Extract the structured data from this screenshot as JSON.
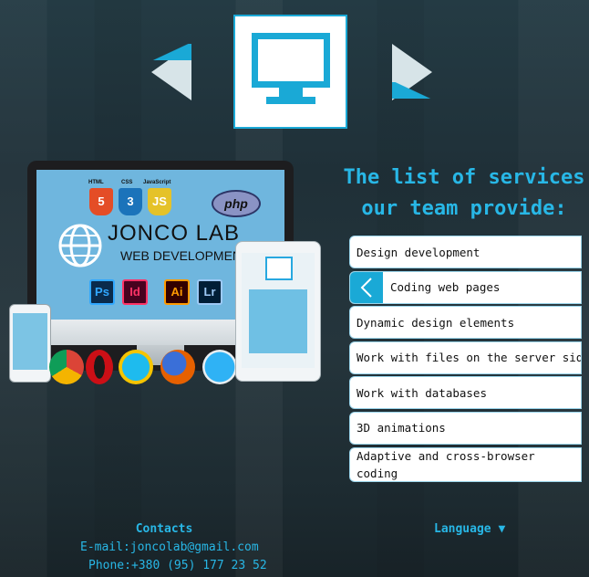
{
  "hero": {
    "tech_badges": [
      "HTML",
      "CSS",
      "JavaScript"
    ],
    "php_label": "php",
    "brand": {
      "title": "JONCO LAB",
      "subtitle": "WEB DEVELOPMENT"
    },
    "app_icons": [
      "Ps",
      "Id",
      "Ai",
      "Lr"
    ]
  },
  "services": {
    "heading_line1": "The list of services",
    "heading_line2": "our team provide:",
    "items": [
      {
        "label": "Design development"
      },
      {
        "label": "Coding web pages"
      },
      {
        "label": "Dynamic design elements"
      },
      {
        "label": "Work with files on the server side"
      },
      {
        "label": "Work with databases"
      },
      {
        "label": "3D animations"
      },
      {
        "label": "Adaptive and cross-browser coding"
      }
    ],
    "active_index": 1
  },
  "footer": {
    "contacts_title": "Contacts",
    "email_line": "E-mail:joncolab@gmail.com",
    "phone_line": "Phone:+380 (95) 177 23 52",
    "language_label": "Language ▼"
  },
  "colors": {
    "accent": "#1aa9d6",
    "heading": "#28b7e6",
    "background": "#1f3038"
  }
}
